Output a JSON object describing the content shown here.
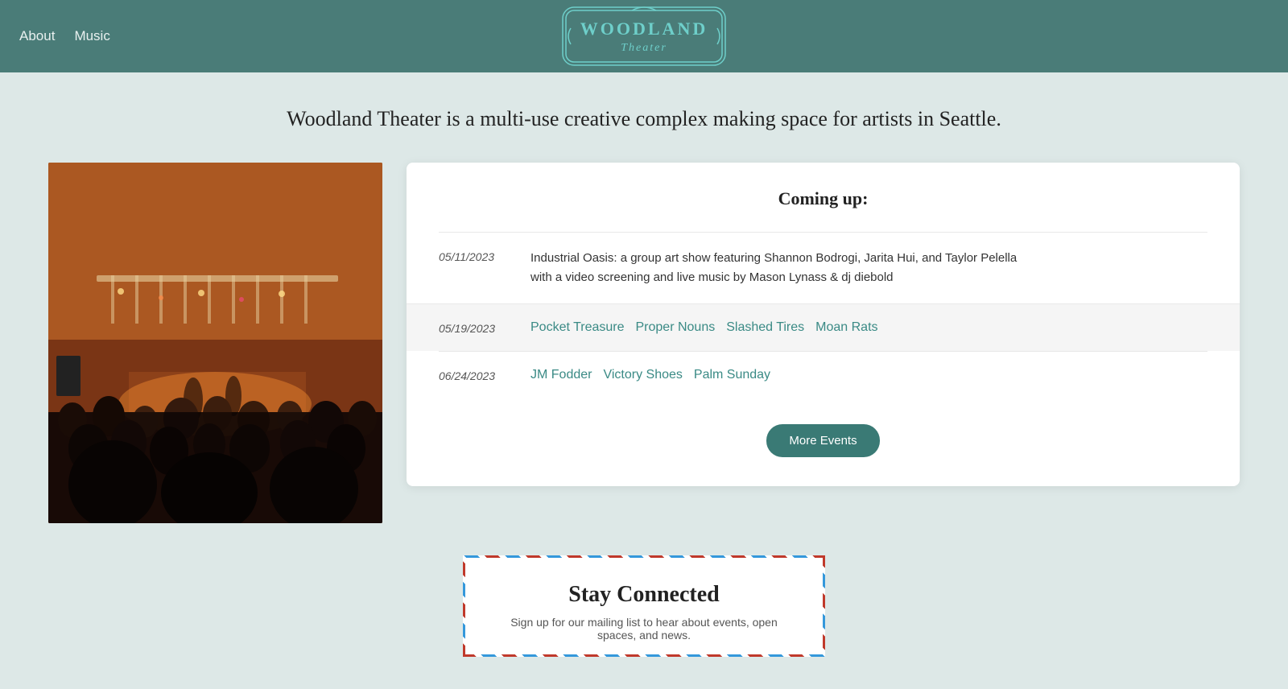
{
  "nav": {
    "about_label": "About",
    "music_label": "Music"
  },
  "logo": {
    "name_top": "WOODLAND",
    "name_bottom": "Theater"
  },
  "tagline": "Woodland Theater is a multi-use creative complex making space for artists in Seattle.",
  "events": {
    "section_title": "Coming up:",
    "items": [
      {
        "date": "05/11/2023",
        "line1": "Industrial Oasis: a group art show featuring Shannon Bodrogi, Jarita Hui, and Taylor Pelella",
        "line2": "with a video screening and live music by Mason Lynass & dj diebold",
        "artists": [],
        "highlight": false
      },
      {
        "date": "05/19/2023",
        "line1": "",
        "line2": "",
        "artists": [
          "Pocket Treasure",
          "Proper Nouns",
          "Slashed Tires",
          "Moan Rats"
        ],
        "highlight": true
      },
      {
        "date": "06/24/2023",
        "line1": "",
        "line2": "",
        "artists": [
          "JM Fodder",
          "Victory Shoes",
          "Palm Sunday"
        ],
        "highlight": false
      }
    ],
    "more_button_label": "More Events"
  },
  "stay_connected": {
    "title": "Stay Connected",
    "subtitle": "Sign up for our mailing list to hear about events, open spaces, and news."
  }
}
